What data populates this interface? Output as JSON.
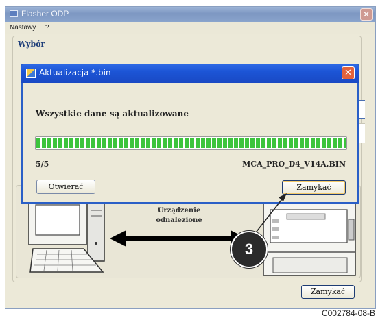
{
  "main_window": {
    "title": "Flasher ODP",
    "close_glyph": "✕",
    "menu": [
      "Nastawy",
      "?"
    ],
    "group_label": "Wybór",
    "close_button": "Zamykać"
  },
  "device_status": {
    "line1": "Urządzenie",
    "line2": "odnalezione"
  },
  "dialog": {
    "title": "Aktualizacja *.bin",
    "close_glyph": "✕",
    "message": "Wszystkie dane są aktualizowane",
    "progress_fraction": 1.0,
    "count": "5/5",
    "filename": "MCA_PRO_D4_V14A.BIN",
    "open_button": "Otwierać",
    "close_button": "Zamykać"
  },
  "callout_number": "3",
  "reference_code": "C002784-08-B",
  "colors": {
    "dialog_title_bar": "#1c55d6",
    "progress_fill": "#3cc43c",
    "window_bg": "#ece9d8"
  },
  "icons": [
    "window-app-icon",
    "close-icon",
    "dialog-app-icon",
    "computer-icon",
    "plc-device-icon",
    "double-arrow-icon"
  ]
}
